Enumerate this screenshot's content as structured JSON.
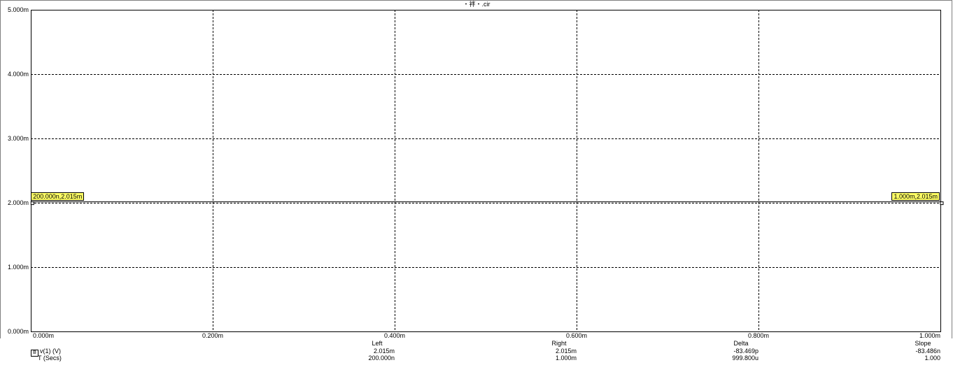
{
  "window": {
    "title": "・袢・.cir"
  },
  "chart_data": {
    "type": "line",
    "title": "・袢・.cir",
    "xlabel": "T (Secs)",
    "ylabel": "",
    "xlim": [
      0,
      1.0
    ],
    "ylim": [
      0,
      5.0
    ],
    "x_ticks": [
      0,
      0.2,
      0.4,
      0.6,
      0.8,
      1.0
    ],
    "x_tick_labels": [
      "0.000m",
      "0.200m",
      "0.400m",
      "0.600m",
      "0.800m",
      "1.000m"
    ],
    "y_ticks": [
      0,
      1,
      2,
      3,
      4,
      5
    ],
    "y_tick_labels": [
      "0.000m",
      "1.000m",
      "2.000m",
      "3.000m",
      "4.000m",
      "5.000m"
    ],
    "grid": true,
    "series": [
      {
        "name": "v(1) (V)",
        "color": "#000000",
        "x": [
          0.0002,
          1.0
        ],
        "y": [
          2.015,
          2.015
        ]
      }
    ],
    "cursors": [
      {
        "x": 0.0002,
        "y": 2.015,
        "label": "200.000n,2.015m"
      },
      {
        "x": 1.0,
        "y": 2.015,
        "label": "1.000m,2.015m"
      }
    ]
  },
  "legend": {
    "trace_marker": "B",
    "trace_name": "v(1) (V)",
    "x_unit": "T (Secs)"
  },
  "measurements": {
    "left": {
      "header": "Left",
      "y": "2.015m",
      "x": "200.000n"
    },
    "right": {
      "header": "Right",
      "y": "2.015m",
      "x": "1.000m"
    },
    "delta": {
      "header": "Delta",
      "y": "-83.469p",
      "x": "999.800u"
    },
    "slope": {
      "header": "Slope",
      "y": "-83.486n",
      "x": "1.000"
    }
  }
}
